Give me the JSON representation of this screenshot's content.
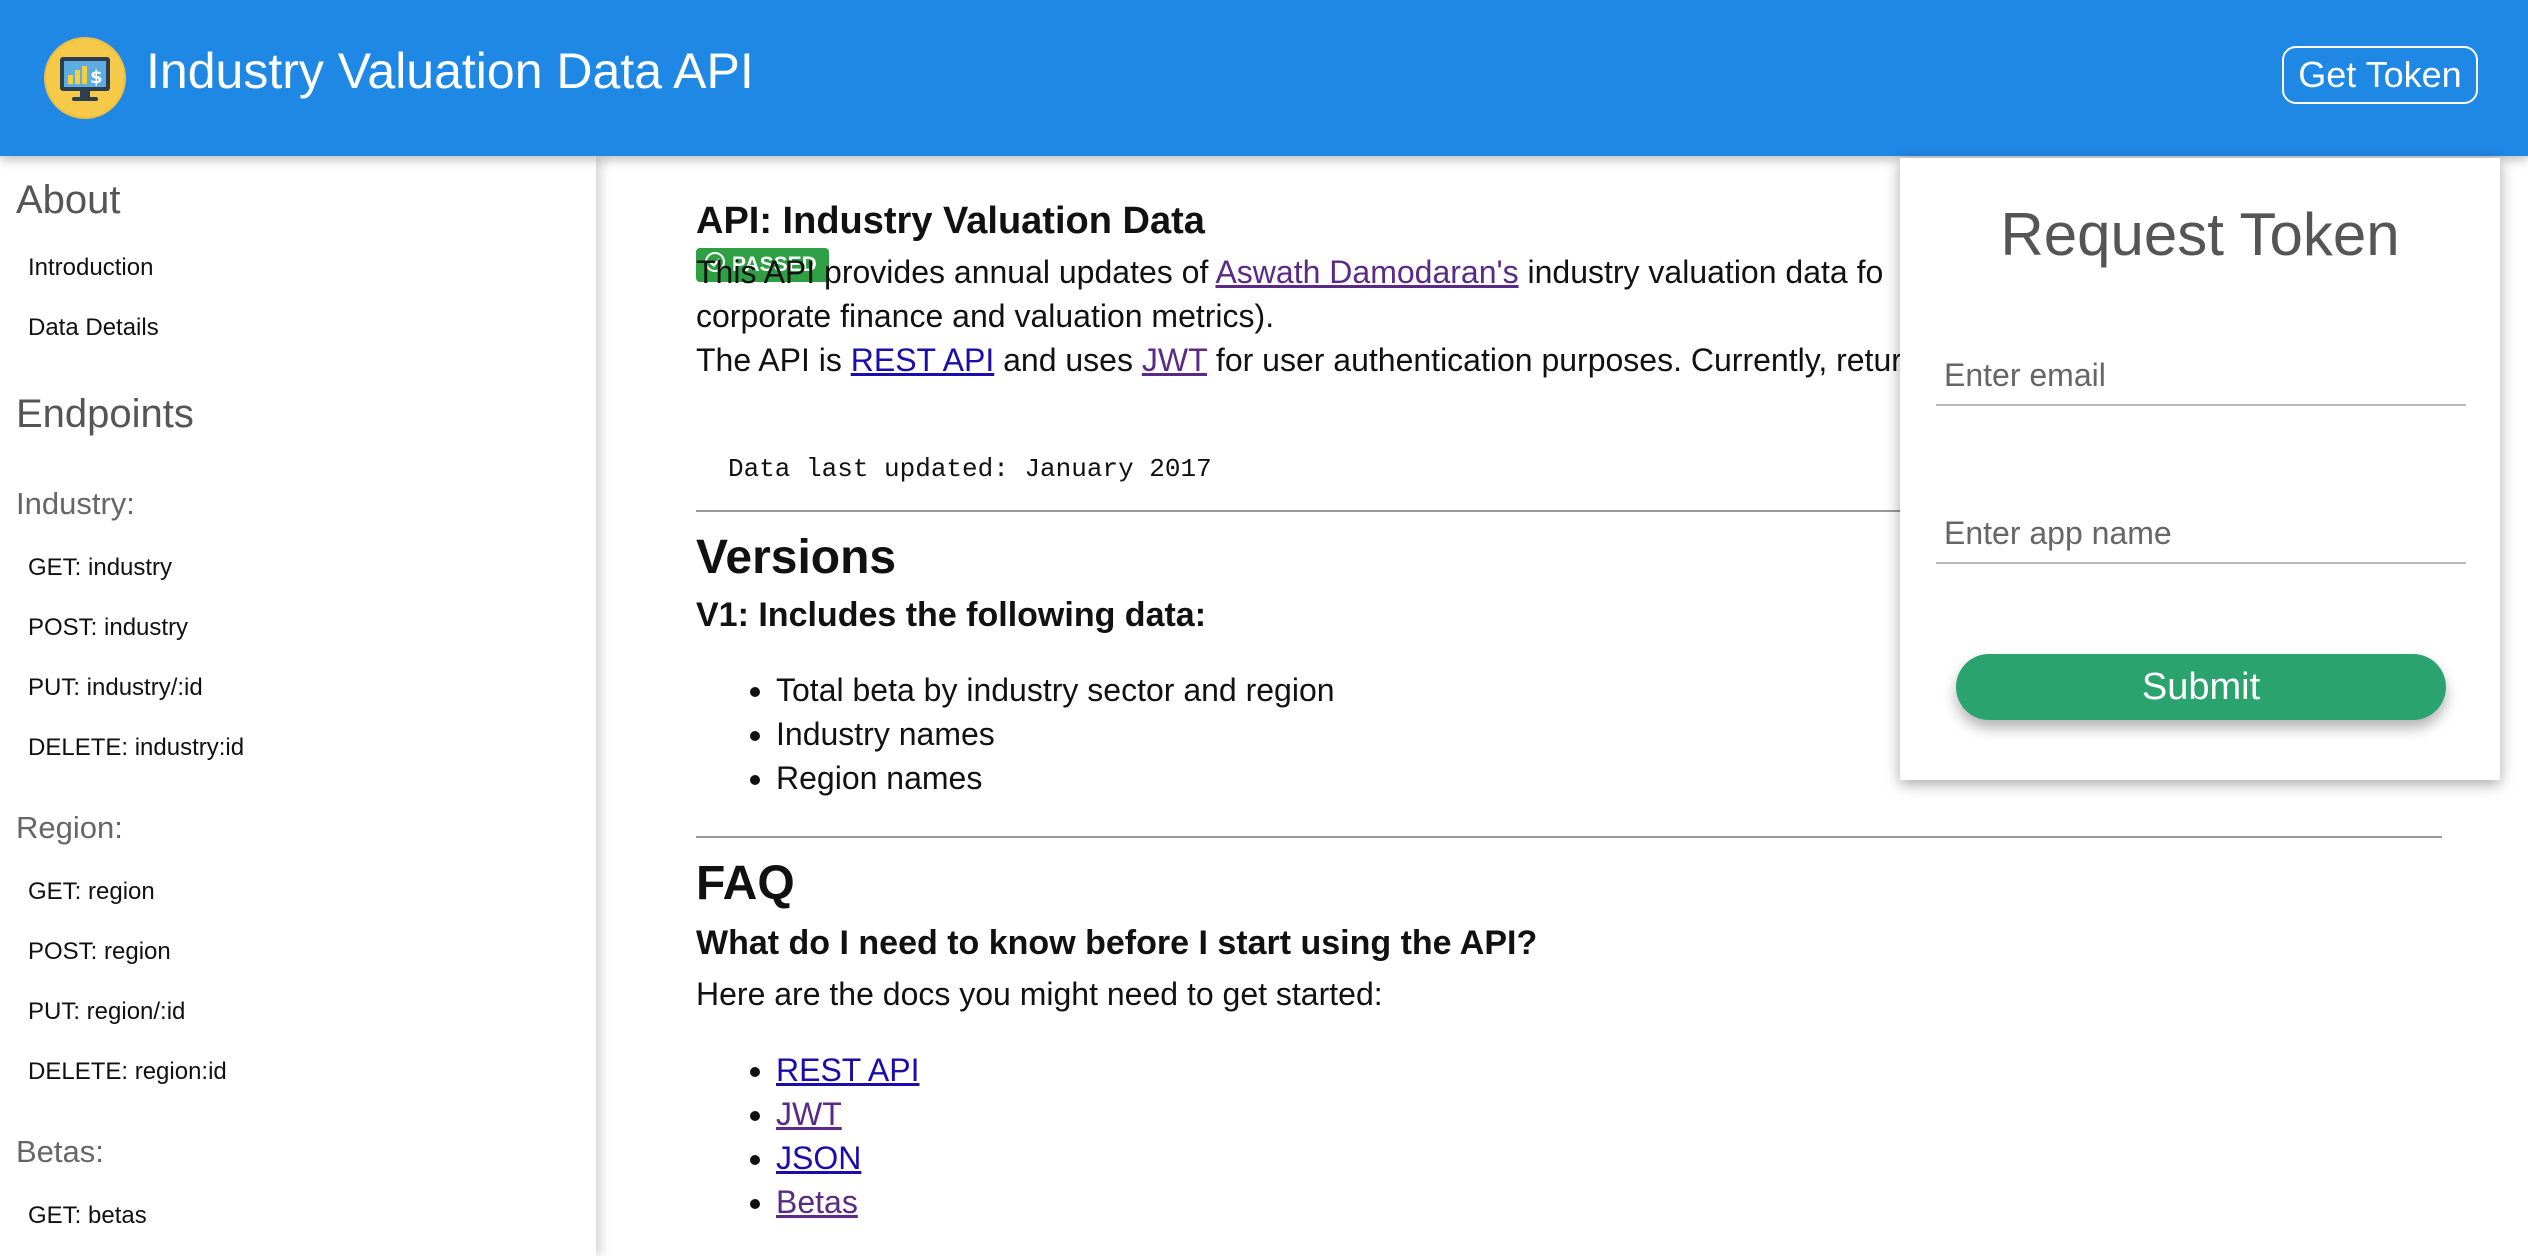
{
  "header": {
    "title": "Industry Valuation Data API",
    "get_token_label": "Get Token",
    "brand_color": "#1f88e5"
  },
  "sidebar": {
    "about_heading": "About",
    "about_items": [
      "Introduction",
      "Data Details"
    ],
    "endpoints_heading": "Endpoints",
    "groups": [
      {
        "label": "Industry:",
        "items": [
          "GET: industry",
          "POST: industry",
          "PUT: industry/:id",
          "DELETE: industry:id"
        ]
      },
      {
        "label": "Region:",
        "items": [
          "GET: region",
          "POST: region",
          "PUT: region/:id",
          "DELETE: region:id"
        ]
      },
      {
        "label": "Betas:",
        "items": [
          "GET: betas"
        ]
      }
    ]
  },
  "main": {
    "title": "API: Industry Valuation Data",
    "badge": "PASSED",
    "intro": {
      "p1_before": "This API provides annual updates of ",
      "p1_link": "Aswath Damodaran's",
      "p1_after": " industry valuation data fo",
      "p2": "corporate finance and valuation metrics).",
      "p3_before": "The API is ",
      "p3_link1": "REST API",
      "p3_mid": " and uses ",
      "p3_link2": "JWT",
      "p3_after": " for user authentication purposes. Currently, retur"
    },
    "updated": "Data last updated: January 2017",
    "versions_heading": "Versions",
    "v1_heading": "V1: Includes the following data:",
    "v1_items": [
      "Total beta by industry sector and region",
      "Industry names",
      "Region names"
    ],
    "faq_heading": "FAQ",
    "faq_q1": "What do I need to know before I start using the API?",
    "faq_a1": "Here are the docs you might need to get started:",
    "doc_links": [
      "REST API",
      "JWT",
      "JSON",
      "Betas"
    ]
  },
  "token_panel": {
    "title": "Request Token",
    "email_placeholder": "Enter email",
    "app_placeholder": "Enter app name",
    "submit_label": "Submit"
  }
}
